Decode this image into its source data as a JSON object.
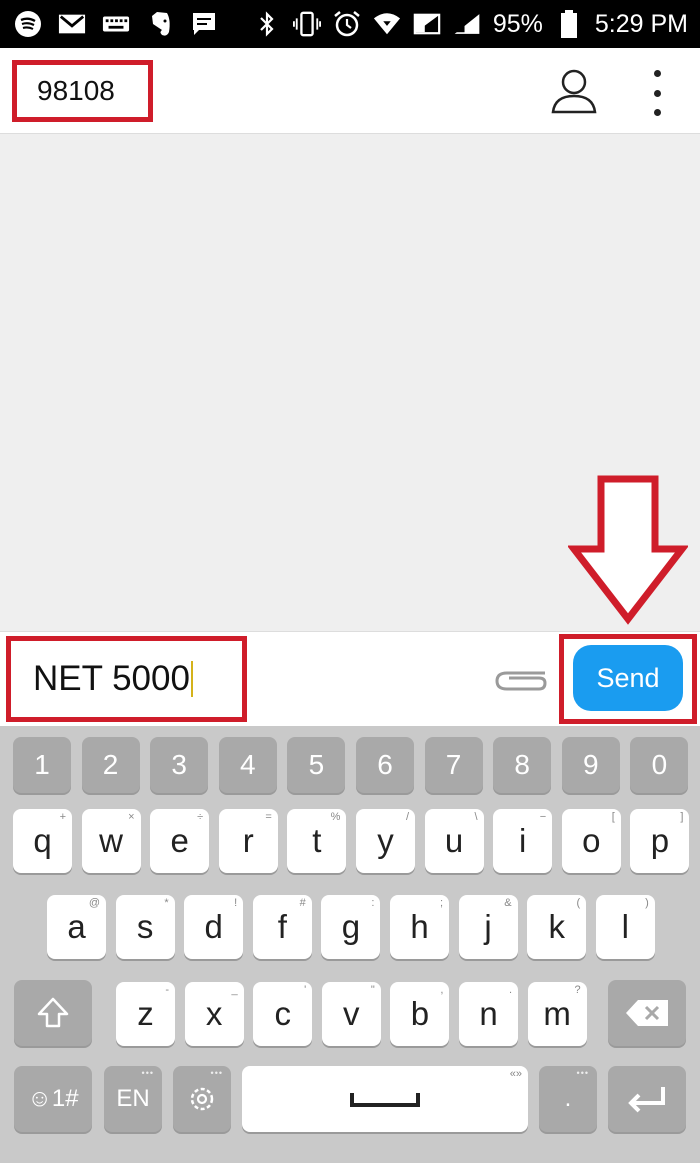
{
  "status_bar": {
    "battery": "95%",
    "time": "5:29 PM",
    "left_icons": [
      "spotify-icon",
      "gmail-icon",
      "keyboard-icon",
      "evernote-icon",
      "message-icon"
    ],
    "right_icons": [
      "bluetooth-icon",
      "vibrate-icon",
      "alarm-icon",
      "wifi-icon",
      "signal-icon",
      "signal-icon",
      "battery-icon"
    ]
  },
  "app_bar": {
    "recipient": "98108",
    "icons": [
      "contact-icon",
      "more-vert-icon"
    ]
  },
  "compose": {
    "message": "NET 5000",
    "send_label": "Send",
    "attach_icon": "paperclip-icon"
  },
  "annotation": {
    "highlight_color": "#cf1d2a",
    "arrow_icon": "down-arrow-icon"
  },
  "keyboard": {
    "number_row": [
      "1",
      "2",
      "3",
      "4",
      "5",
      "6",
      "7",
      "8",
      "9",
      "0"
    ],
    "row1": [
      {
        "key": "q",
        "hint": "+"
      },
      {
        "key": "w",
        "hint": "×"
      },
      {
        "key": "e",
        "hint": "÷"
      },
      {
        "key": "r",
        "hint": "="
      },
      {
        "key": "t",
        "hint": "%"
      },
      {
        "key": "y",
        "hint": "/"
      },
      {
        "key": "u",
        "hint": "\\"
      },
      {
        "key": "i",
        "hint": "−"
      },
      {
        "key": "o",
        "hint": "["
      },
      {
        "key": "p",
        "hint": "]"
      }
    ],
    "row2": [
      {
        "key": "a",
        "hint": "@"
      },
      {
        "key": "s",
        "hint": "*"
      },
      {
        "key": "d",
        "hint": "!"
      },
      {
        "key": "f",
        "hint": "#"
      },
      {
        "key": "g",
        "hint": ":"
      },
      {
        "key": "h",
        "hint": ";"
      },
      {
        "key": "j",
        "hint": "&"
      },
      {
        "key": "k",
        "hint": "("
      },
      {
        "key": "l",
        "hint": ")"
      }
    ],
    "row3": [
      {
        "key": "z",
        "hint": "-"
      },
      {
        "key": "x",
        "hint": "_"
      },
      {
        "key": "c",
        "hint": "'"
      },
      {
        "key": "v",
        "hint": "\""
      },
      {
        "key": "b",
        "hint": ","
      },
      {
        "key": "n",
        "hint": "."
      },
      {
        "key": "m",
        "hint": "?"
      }
    ],
    "symbols_label": "☺1#",
    "lang_label": "EN",
    "period_label": ".",
    "icons": [
      "shift-icon",
      "backspace-icon",
      "settings-icon",
      "space-icon",
      "enter-icon"
    ]
  }
}
